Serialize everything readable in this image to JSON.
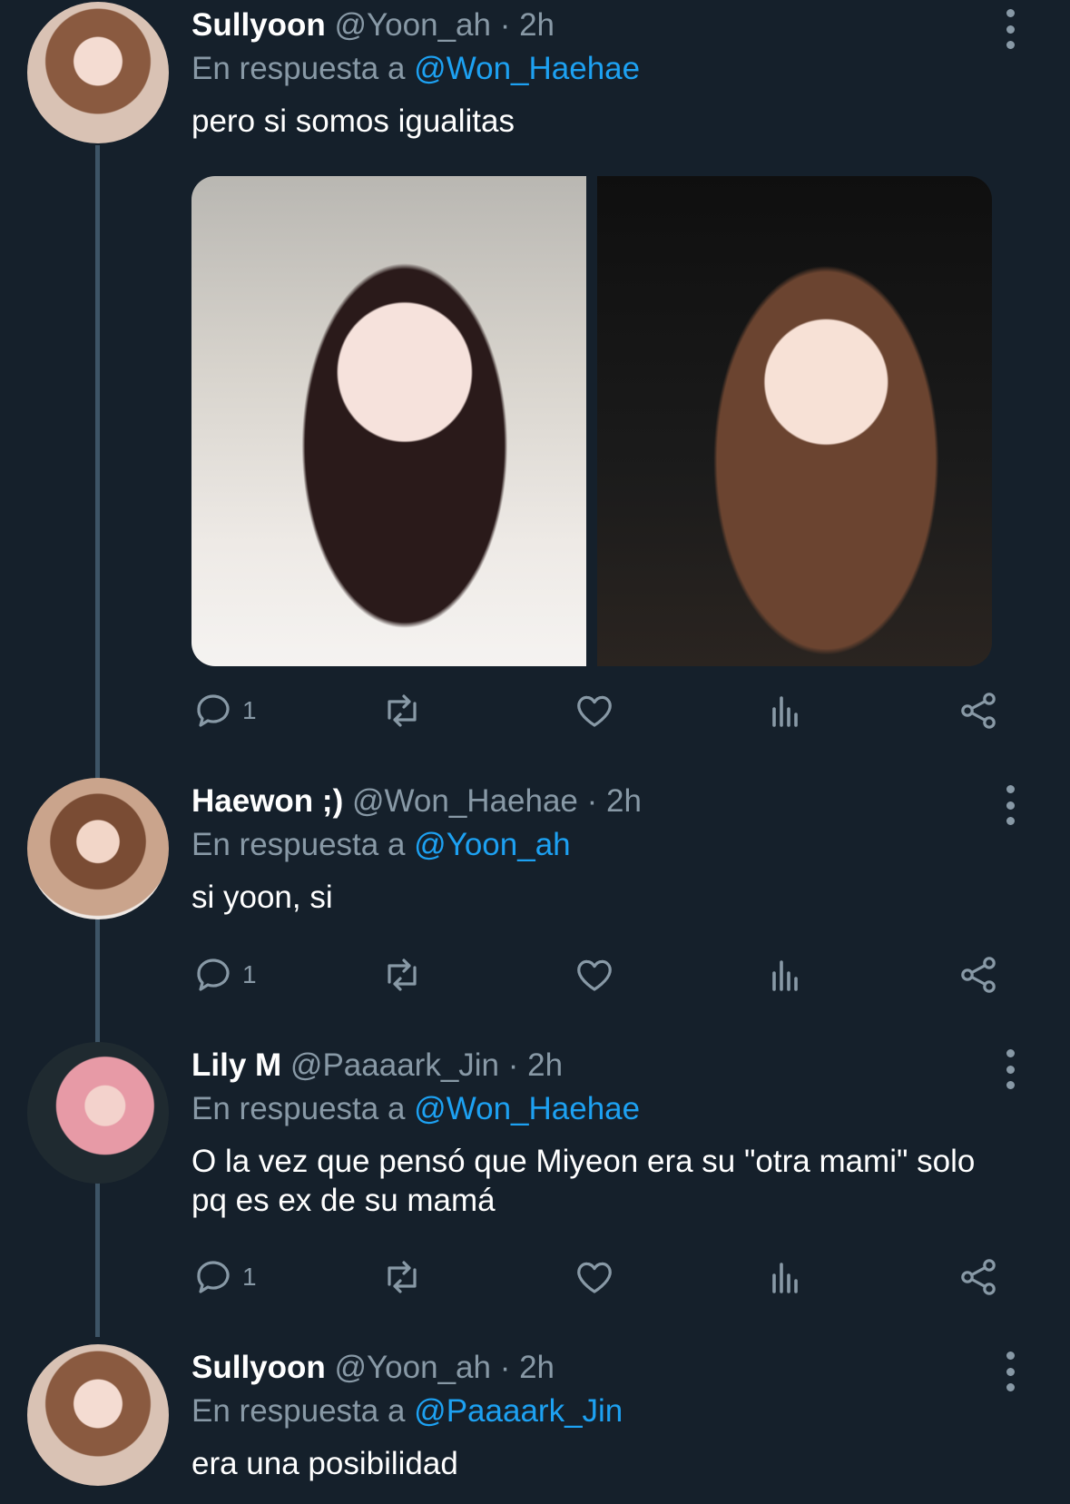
{
  "tweets": [
    {
      "name": "Sullyoon",
      "handle": "@Yoon_ah · 2h",
      "reply_prefix": "En respuesta a",
      "reply_to": "@Won_Haehae",
      "text": "pero si somos igualitas",
      "has_media": true,
      "reply_count": "1",
      "avatar": "sullyoon-avatar"
    },
    {
      "name": "Haewon ;)",
      "handle": "@Won_Haehae · 2h",
      "reply_prefix": "En respuesta a",
      "reply_to": "@Yoon_ah",
      "text": "si yoon, si",
      "reply_count": "1",
      "avatar": "haewon-avatar"
    },
    {
      "name": "Lily M",
      "handle": "@Paaaark_Jin · 2h",
      "reply_prefix": "En respuesta a",
      "reply_to": "@Won_Haehae",
      "text": "O la vez que pensó que Miyeon era su \"otra mami\" solo pq es ex de su mamá",
      "reply_count": "1",
      "avatar": "lily-avatar"
    },
    {
      "name": "Sullyoon",
      "handle": "@Yoon_ah · 2h",
      "reply_prefix": "En respuesta a",
      "reply_to": "@Paaaark_Jin",
      "text": "era una posibilidad",
      "avatar": "sullyoon-avatar"
    }
  ],
  "icons": {
    "reply": "reply-icon",
    "retweet": "retweet-icon",
    "like": "heart-icon",
    "analytics": "analytics-icon",
    "share": "share-icon",
    "more": "more-vertical-icon"
  },
  "colors": {
    "background": "#15202b",
    "secondary_text": "#8899a6",
    "mention": "#1da1f2",
    "thread_line": "#3d5466"
  }
}
